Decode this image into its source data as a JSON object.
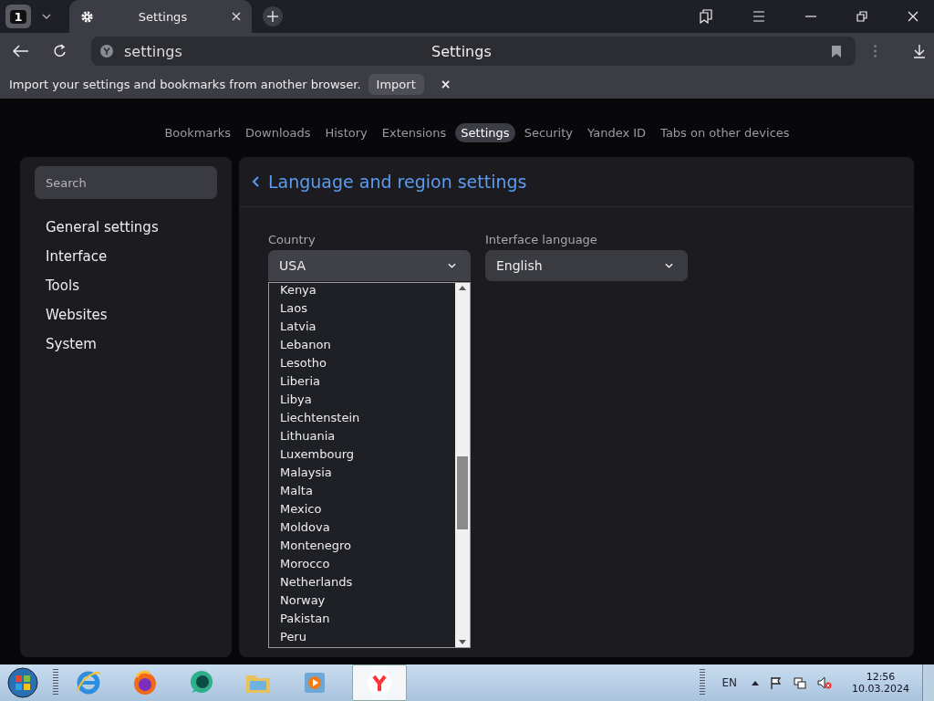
{
  "tab_counter": "1",
  "tab": {
    "title": "Settings",
    "selected": true
  },
  "address_bar": {
    "value": "settings",
    "page_title": "Settings"
  },
  "infobar": {
    "message": "Import your settings and bookmarks from another browser.",
    "button": "Import",
    "close": "×"
  },
  "nav": [
    {
      "label": "Bookmarks",
      "selected": false
    },
    {
      "label": "Downloads",
      "selected": false
    },
    {
      "label": "History",
      "selected": false
    },
    {
      "label": "Extensions",
      "selected": false
    },
    {
      "label": "Settings",
      "selected": true
    },
    {
      "label": "Security",
      "selected": false
    },
    {
      "label": "Yandex ID",
      "selected": false
    },
    {
      "label": "Tabs on other devices",
      "selected": false
    }
  ],
  "sidebar": {
    "search_placeholder": "Search",
    "items": [
      "General settings",
      "Interface",
      "Tools",
      "Websites",
      "System"
    ]
  },
  "section_title": "Language and region settings",
  "fields": [
    {
      "label": "Country",
      "value": "USA",
      "expanded": true
    },
    {
      "label": "Interface language",
      "value": "English",
      "expanded": false
    }
  ],
  "country_options": [
    "Kenya",
    "Laos",
    "Latvia",
    "Lebanon",
    "Lesotho",
    "Liberia",
    "Libya",
    "Liechtenstein",
    "Lithuania",
    "Luxembourg",
    "Malaysia",
    "Malta",
    "Mexico",
    "Moldova",
    "Montenegro",
    "Morocco",
    "Netherlands",
    "Norway",
    "Pakistan",
    "Peru"
  ],
  "taskbar": {
    "language": "EN",
    "time": "12:56",
    "date": "10.03.2024"
  }
}
